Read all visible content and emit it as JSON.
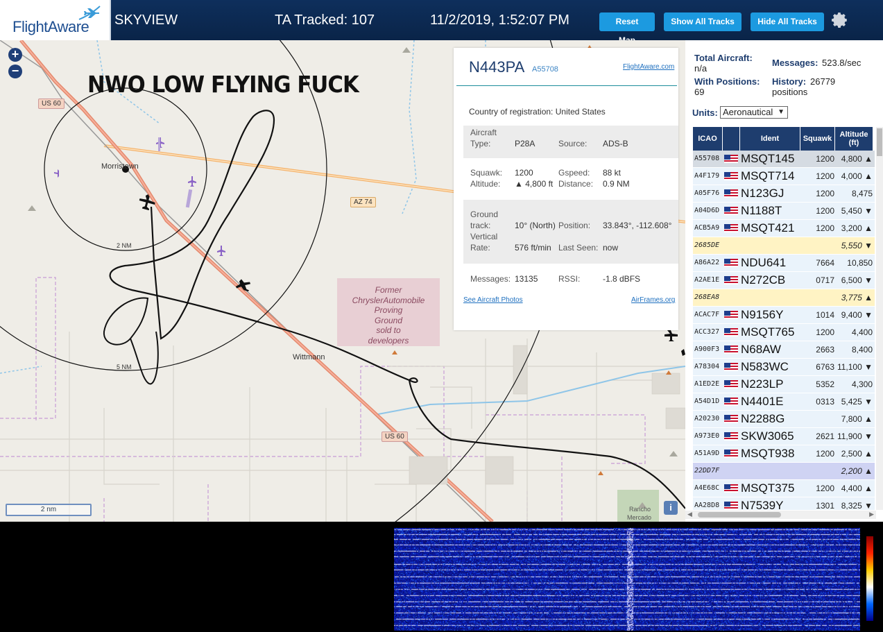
{
  "header": {
    "logo_text": "FlightAware",
    "app_title": "SKYVIEW",
    "ta_tracked": "TA Tracked: 107",
    "datetime": "11/2/2019, 1:52:07 PM",
    "reset_map": "Reset Map",
    "show_all_tracks": "Show All Tracks",
    "hide_all_tracks": "Hide All Tracks",
    "settings_icon": "gear-icon"
  },
  "map": {
    "overlay_text": "NWO LOW FLYING FUCK",
    "zoom_in": "+",
    "zoom_out": "−",
    "labels": {
      "morristown": "Morristown",
      "wittmann": "Wittmann",
      "ring_2nm": "2 NM",
      "ring_5nm": "5 NM",
      "us60_top": "US 60",
      "us60_bottom": "US 60",
      "az74": "AZ 74",
      "rancho": "Rancho",
      "mercado": "Mercado"
    },
    "proving_ground": [
      "Former",
      "ChryslerAutomobile",
      "Proving",
      "Ground",
      "sold to",
      "developers"
    ],
    "scale": "2 nm",
    "info": "i"
  },
  "popup": {
    "callsign": "N443PA",
    "icao": "A55708",
    "link": "FlightAware.com",
    "country_label": "Country of registration:",
    "country": "United States",
    "aircraft_type_label_1": "Aircraft",
    "aircraft_type_label_2": "Type:",
    "aircraft_type": "P28A",
    "source_label": "Source:",
    "source": "ADS-B",
    "squawk_label": "Squawk:",
    "squawk": "1200",
    "gspeed_label": "Gspeed:",
    "gspeed": "88 kt",
    "altitude_label": "Altitude:",
    "altitude": "▲ 4,800 ft",
    "distance_label": "Distance:",
    "distance": "0.9 NM",
    "ground_label_1": "Ground",
    "ground_label_2": "track:",
    "ground_track": "10° (North)",
    "position_label": "Position:",
    "position": "33.843°, -112.608°",
    "vrate_label_1": "Vertical",
    "vrate_label_2": "Rate:",
    "vertical_rate": "576 ft/min",
    "last_seen_label": "Last Seen:",
    "last_seen": "now",
    "messages_label": "Messages:",
    "messages": "13135",
    "rssi_label": "RSSI:",
    "rssi": "-1.8 dBFS",
    "photos_link": "See Aircraft Photos",
    "airframes_link": "AirFrames.org"
  },
  "panel": {
    "total_aircraft_label": "Total Aircraft:",
    "total_aircraft": "n/a",
    "messages_label": "Messages:",
    "messages": "523.8/sec",
    "with_positions_label": "With Positions:",
    "with_positions": "69",
    "history_label": "History:",
    "history": "26779",
    "history_unit": "positions",
    "units_label": "Units:",
    "units_value": "Aeronautical",
    "columns": [
      "ICAO",
      "Ident",
      "Squawk",
      "Altitude (ft)"
    ],
    "rows": [
      {
        "icao": "A55708",
        "flag": true,
        "ident": "MSQT145",
        "squawk": "1200",
        "alt": "4,800 ▲",
        "style": "selected"
      },
      {
        "icao": "A4F179",
        "flag": true,
        "ident": "MSQT714",
        "squawk": "1200",
        "alt": "4,000 ▲",
        "style": "normal"
      },
      {
        "icao": "A05F76",
        "flag": true,
        "ident": "N123GJ",
        "squawk": "1200",
        "alt": "8,475",
        "style": "normal"
      },
      {
        "icao": "A04D6D",
        "flag": true,
        "ident": "N1188T",
        "squawk": "1200",
        "alt": "5,450 ▼",
        "style": "normal"
      },
      {
        "icao": "ACB5A9",
        "flag": true,
        "ident": "MSQT421",
        "squawk": "1200",
        "alt": "3,200 ▲",
        "style": "normal"
      },
      {
        "icao": "2685DE",
        "flag": false,
        "ident": "",
        "squawk": "",
        "alt": "5,550 ▼",
        "style": "yellow"
      },
      {
        "icao": "A86A22",
        "flag": true,
        "ident": "NDU641",
        "squawk": "7664",
        "alt": "10,850",
        "style": "normal"
      },
      {
        "icao": "A2AE1E",
        "flag": true,
        "ident": "N272CB",
        "squawk": "0717",
        "alt": "6,500 ▼",
        "style": "normal"
      },
      {
        "icao": "268EA8",
        "flag": false,
        "ident": "",
        "squawk": "",
        "alt": "3,775 ▲",
        "style": "yellow"
      },
      {
        "icao": "ACAC7F",
        "flag": true,
        "ident": "N9156Y",
        "squawk": "1014",
        "alt": "9,400 ▼",
        "style": "normal"
      },
      {
        "icao": "ACC327",
        "flag": true,
        "ident": "MSQT765",
        "squawk": "1200",
        "alt": "4,400",
        "style": "normal"
      },
      {
        "icao": "A900F3",
        "flag": true,
        "ident": "N68AW",
        "squawk": "2663",
        "alt": "8,400",
        "style": "normal"
      },
      {
        "icao": "A78304",
        "flag": true,
        "ident": "N583WC",
        "squawk": "6763",
        "alt": "11,100 ▼",
        "style": "normal"
      },
      {
        "icao": "A1ED2E",
        "flag": true,
        "ident": "N223LP",
        "squawk": "5352",
        "alt": "4,300",
        "style": "normal"
      },
      {
        "icao": "A54D1D",
        "flag": true,
        "ident": "N4401E",
        "squawk": "0313",
        "alt": "5,425 ▼",
        "style": "normal"
      },
      {
        "icao": "A20230",
        "flag": true,
        "ident": "N2288G",
        "squawk": "",
        "alt": "7,800 ▲",
        "style": "normal"
      },
      {
        "icao": "A973E0",
        "flag": true,
        "ident": "SKW3065",
        "squawk": "2621",
        "alt": "11,900 ▼",
        "style": "normal"
      },
      {
        "icao": "A51A9D",
        "flag": true,
        "ident": "MSQT938",
        "squawk": "1200",
        "alt": "2,500 ▲",
        "style": "normal"
      },
      {
        "icao": "22DD7F",
        "flag": false,
        "ident": "",
        "squawk": "",
        "alt": "2,200 ▲",
        "style": "purple"
      },
      {
        "icao": "A4E68C",
        "flag": true,
        "ident": "MSQT375",
        "squawk": "1200",
        "alt": "4,400 ▲",
        "style": "normal"
      },
      {
        "icao": "AA28D8",
        "flag": true,
        "ident": "N7539Y",
        "squawk": "1301",
        "alt": "8,325 ▼",
        "style": "normal"
      }
    ]
  },
  "colors": {
    "header_bg": "#0a2448",
    "button_bg": "#1c9ae0",
    "table_header": "#1e3d6e",
    "row_normal": "#eaf3fb",
    "row_selected": "#d5dbe2",
    "row_yellow": "#fff3c4",
    "row_purple": "#cfd3f3",
    "track": "#111111",
    "road_orange": "#f0a060"
  }
}
